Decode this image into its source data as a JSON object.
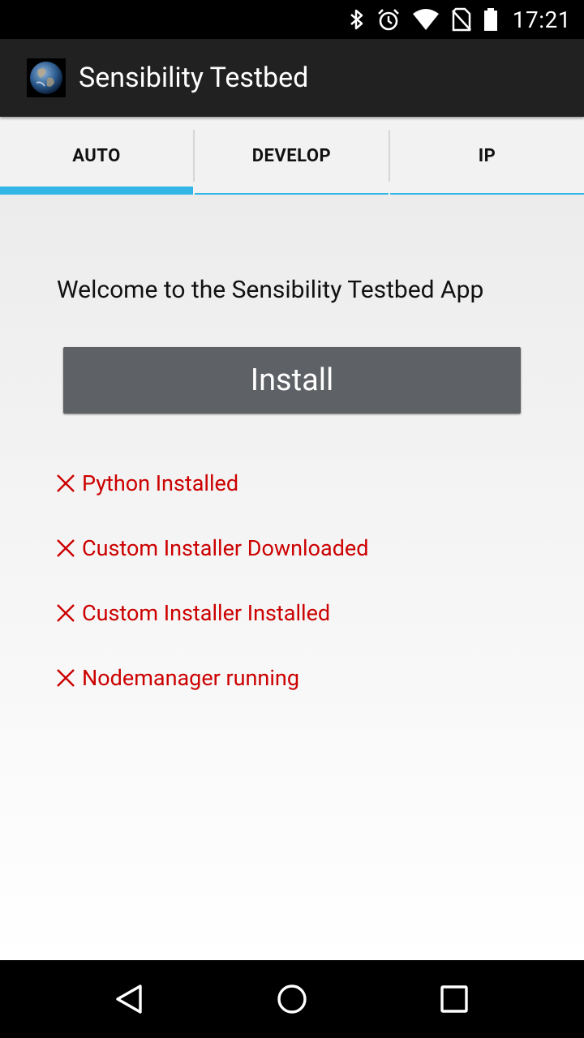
{
  "status_bar": {
    "time": "17:21",
    "icons": [
      "bluetooth-icon",
      "alarm-icon",
      "wifi-icon",
      "no-sim-icon",
      "battery-icon"
    ]
  },
  "app_bar": {
    "title": "Sensibility Testbed",
    "logo": "earth-icon"
  },
  "tabs": [
    {
      "label": "AUTO",
      "selected": true
    },
    {
      "label": "DEVELOP",
      "selected": false
    },
    {
      "label": "IP",
      "selected": false
    }
  ],
  "main": {
    "welcome": "Welcome to the Sensibility Testbed App",
    "install_label": "Install",
    "checks": [
      {
        "label": "Python Installed",
        "icon": "x-icon"
      },
      {
        "label": "Custom Installer Downloaded",
        "icon": "x-icon"
      },
      {
        "label": "Custom Installer Installed",
        "icon": "x-icon"
      },
      {
        "label": "Nodemanager running",
        "icon": "x-icon"
      }
    ]
  },
  "nav_bar": {
    "icons": [
      "back-icon",
      "home-icon",
      "recents-icon"
    ]
  },
  "colors": {
    "accent": "#33b5e5",
    "error": "#cc0000",
    "app_bar": "#212121",
    "button": "#5e6165"
  }
}
